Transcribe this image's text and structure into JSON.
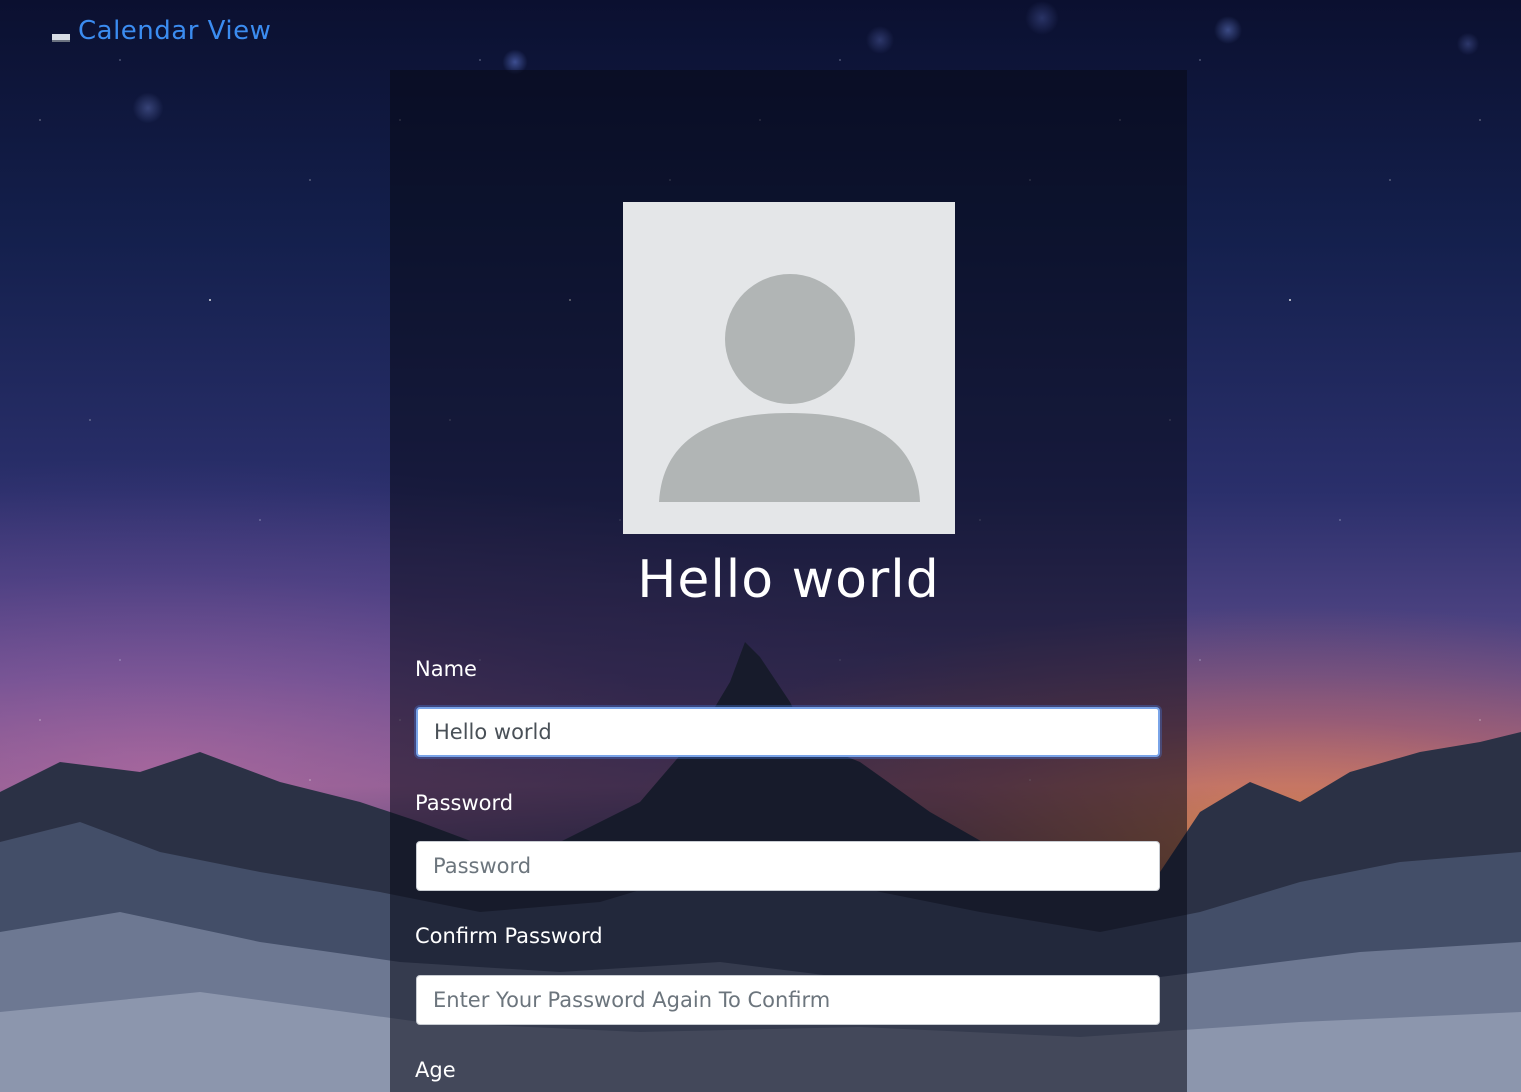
{
  "header": {
    "collapse_icon": "minimize-icon",
    "calendar_link_label": "Calendar View"
  },
  "profile": {
    "avatar_icon": "user-silhouette-icon",
    "display_name": "Hello world"
  },
  "form": {
    "name": {
      "label": "Name",
      "value": "Hello world",
      "placeholder": ""
    },
    "password": {
      "label": "Password",
      "value": "",
      "placeholder": "Password"
    },
    "confirm_password": {
      "label": "Confirm Password",
      "value": "",
      "placeholder": "Enter Your Password Again To Confirm"
    },
    "age": {
      "label": "Age"
    }
  },
  "colors": {
    "link": "#3b8cf0",
    "avatar_bg": "#e4e6e8",
    "avatar_fg": "#b1b5b5",
    "focus_border": "#7aa4e8"
  }
}
